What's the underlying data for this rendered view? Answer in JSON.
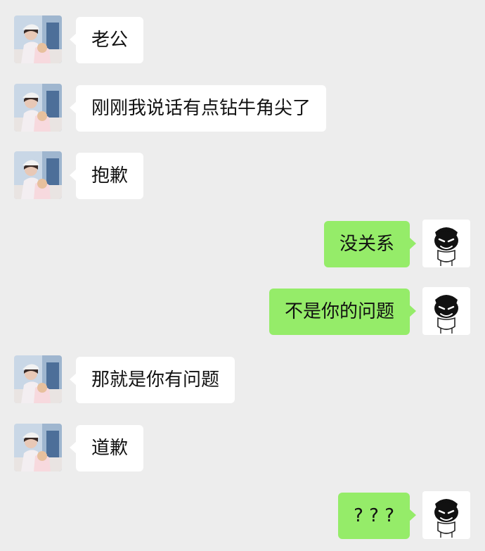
{
  "colors": {
    "background": "#ededed",
    "incoming_bubble": "#ffffff",
    "outgoing_bubble": "#95ec69",
    "text": "#111111"
  },
  "messages": [
    {
      "sender": "left",
      "avatar": "woman-photo-avatar",
      "text": "老公"
    },
    {
      "sender": "left",
      "avatar": "woman-photo-avatar",
      "text": "刚刚我说话有点钻牛角尖了"
    },
    {
      "sender": "left",
      "avatar": "woman-photo-avatar",
      "text": "抱歉"
    },
    {
      "sender": "right",
      "avatar": "cartoon-face-avatar",
      "text": "没关系"
    },
    {
      "sender": "right",
      "avatar": "cartoon-face-avatar",
      "text": "不是你的问题"
    },
    {
      "sender": "left",
      "avatar": "woman-photo-avatar",
      "text": "那就是你有问题"
    },
    {
      "sender": "left",
      "avatar": "woman-photo-avatar",
      "text": "道歉"
    },
    {
      "sender": "right",
      "avatar": "cartoon-face-avatar",
      "text": "? ? ?"
    }
  ]
}
